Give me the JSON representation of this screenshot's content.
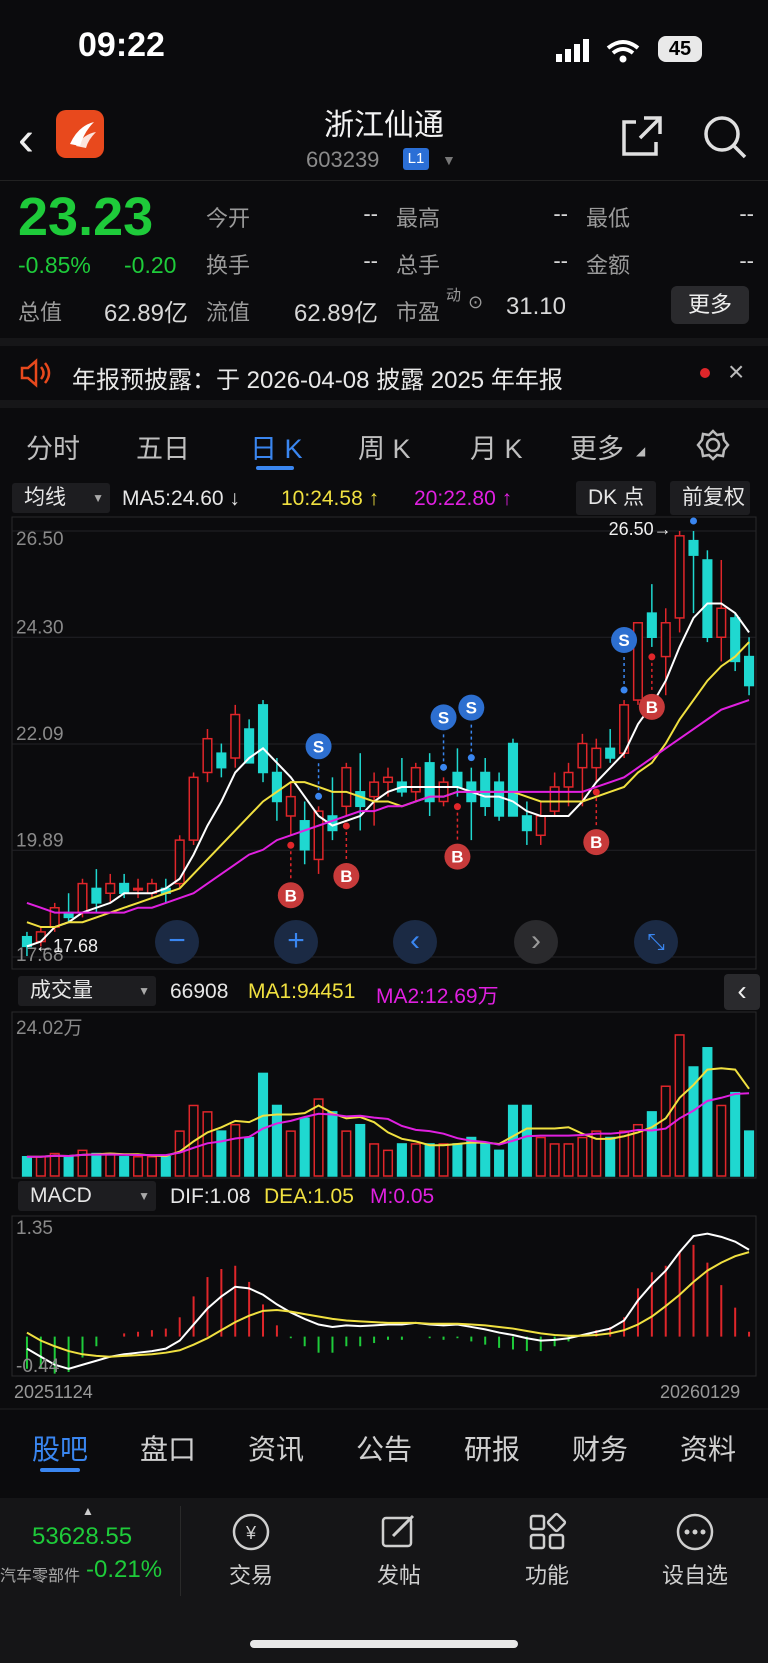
{
  "status_bar": {
    "time": "09:22",
    "battery": "45"
  },
  "header": {
    "title": "浙江仙通",
    "code": "603239",
    "level_badge": "L1"
  },
  "quote": {
    "price": "23.23",
    "change_pct": "-0.85%",
    "change_amt": "-0.20",
    "fields": [
      {
        "label": "今开",
        "value": "--"
      },
      {
        "label": "最高",
        "value": "--"
      },
      {
        "label": "最低",
        "value": "--"
      },
      {
        "label": "换手",
        "value": "--"
      },
      {
        "label": "总手",
        "value": "--"
      },
      {
        "label": "金额",
        "value": "--"
      },
      {
        "label": "总值",
        "value": "62.89亿"
      },
      {
        "label": "流值",
        "value": "62.89亿"
      },
      {
        "label": "市盈",
        "value": "31.10"
      }
    ],
    "pe_super": "动",
    "more_button": "更多",
    "price_color": "#1ecb3a"
  },
  "notice": {
    "text": "年报预披露：于 2026-04-08 披露 2025 年年报"
  },
  "chart_tabs": [
    "分时",
    "五日",
    "日 K",
    "周 K",
    "月 K",
    "更多"
  ],
  "active_chart_tab": "日 K",
  "main_chart": {
    "indicator_select": "均线",
    "ma5": "MA5:24.60 ↓",
    "ma10": "10:24.58 ↑",
    "ma20": "20:22.80 ↑",
    "dk_button": "DK 点",
    "adjust_button": "前复权",
    "max_label": "26.50→",
    "min_label": "←17.68",
    "colors": {
      "up": "#e0262a",
      "down": "#1fd8d0",
      "ma5": "#ffffff",
      "ma10": "#f0e040",
      "ma20": "#e020e0"
    }
  },
  "volume_panel": {
    "select": "成交量",
    "vol": "66908",
    "ma1": "MA1:94451",
    "ma2": "MA2:12.69万",
    "top_label": "24.02万"
  },
  "macd_panel": {
    "select": "MACD",
    "dif": "DIF:1.08",
    "dea": "DEA:1.05",
    "m": "M:0.05",
    "top_label": "1.35",
    "bottom_label": "-0.44"
  },
  "date_start": "20251124",
  "date_end": "20260129",
  "bottom_tabs": [
    "股吧",
    "盘口",
    "资讯",
    "公告",
    "研报",
    "财务",
    "资料"
  ],
  "dock": {
    "index_value": "53628.55",
    "index_name": "汽车零部件",
    "index_change": "-0.21%",
    "items": [
      {
        "label": "交易",
        "icon": "yen-icon"
      },
      {
        "label": "发帖",
        "icon": "edit-icon"
      },
      {
        "label": "功能",
        "icon": "grid-icon"
      },
      {
        "label": "设自选",
        "icon": "more-icon"
      }
    ]
  },
  "chart_data": {
    "type": "candlestick",
    "y_ticks": [
      "26.50",
      "24.30",
      "22.09",
      "19.89",
      "17.68"
    ],
    "ylim": [
      17.68,
      26.5
    ],
    "candles": [
      [
        18.1,
        18.2,
        17.7,
        17.9
      ],
      [
        18.0,
        18.3,
        17.9,
        18.2
      ],
      [
        18.3,
        18.8,
        18.2,
        18.7
      ],
      [
        18.6,
        19.0,
        18.4,
        18.5
      ],
      [
        18.6,
        19.3,
        18.5,
        19.2
      ],
      [
        19.1,
        19.5,
        18.6,
        18.8
      ],
      [
        19.0,
        19.4,
        18.8,
        19.2
      ],
      [
        19.2,
        19.4,
        18.9,
        19.0
      ],
      [
        19.1,
        19.3,
        18.9,
        19.1
      ],
      [
        19.0,
        19.3,
        18.9,
        19.2
      ],
      [
        19.1,
        19.3,
        18.8,
        19.0
      ],
      [
        19.2,
        20.2,
        19.1,
        20.1
      ],
      [
        20.1,
        21.5,
        20.0,
        21.4
      ],
      [
        21.5,
        22.4,
        21.3,
        22.2
      ],
      [
        21.9,
        22.1,
        21.4,
        21.6
      ],
      [
        21.8,
        22.9,
        21.6,
        22.7
      ],
      [
        22.4,
        22.6,
        21.7,
        21.7
      ],
      [
        22.9,
        23.0,
        21.3,
        21.5
      ],
      [
        21.5,
        21.8,
        20.5,
        20.9
      ],
      [
        20.6,
        21.3,
        20.2,
        21.0
      ],
      [
        20.5,
        20.9,
        19.6,
        19.9
      ],
      [
        19.7,
        20.8,
        19.4,
        20.7
      ],
      [
        20.6,
        21.4,
        20.1,
        20.3
      ],
      [
        20.8,
        21.7,
        20.6,
        21.6
      ],
      [
        21.1,
        21.9,
        20.3,
        20.8
      ],
      [
        21.0,
        21.5,
        20.4,
        21.3
      ],
      [
        21.3,
        21.6,
        21.0,
        21.4
      ],
      [
        21.3,
        21.8,
        21.0,
        21.1
      ],
      [
        21.1,
        21.7,
        20.9,
        21.6
      ],
      [
        21.7,
        21.9,
        20.6,
        20.9
      ],
      [
        20.9,
        21.4,
        20.8,
        21.3
      ],
      [
        21.5,
        22.0,
        21.0,
        21.2
      ],
      [
        21.3,
        21.6,
        20.1,
        20.9
      ],
      [
        21.5,
        21.8,
        20.6,
        20.8
      ],
      [
        21.3,
        21.5,
        20.5,
        20.6
      ],
      [
        22.1,
        22.2,
        20.6,
        20.6
      ],
      [
        20.6,
        20.9,
        20.0,
        20.3
      ],
      [
        20.2,
        20.9,
        20.0,
        20.6
      ],
      [
        20.7,
        21.5,
        20.6,
        21.2
      ],
      [
        21.2,
        21.7,
        20.8,
        21.5
      ],
      [
        21.6,
        22.3,
        20.8,
        22.1
      ],
      [
        21.6,
        22.2,
        21.3,
        22.0
      ],
      [
        22.0,
        22.4,
        21.7,
        21.8
      ],
      [
        21.9,
        23.0,
        21.8,
        22.9
      ],
      [
        23.0,
        24.6,
        22.9,
        24.6
      ],
      [
        24.8,
        25.4,
        24.1,
        24.3
      ],
      [
        23.9,
        24.9,
        23.1,
        24.6
      ],
      [
        24.7,
        26.5,
        24.4,
        26.4
      ],
      [
        26.3,
        26.5,
        24.8,
        26.0
      ],
      [
        25.9,
        26.1,
        24.2,
        24.3
      ],
      [
        24.3,
        25.9,
        23.8,
        24.9
      ],
      [
        24.7,
        24.8,
        23.6,
        23.8
      ],
      [
        23.9,
        24.3,
        23.1,
        23.3
      ]
    ],
    "ma5": [
      17.9,
      18.0,
      18.3,
      18.4,
      18.6,
      18.7,
      18.8,
      19.0,
      19.0,
      19.0,
      19.1,
      19.3,
      19.8,
      20.4,
      20.9,
      21.5,
      21.8,
      22.0,
      21.7,
      21.4,
      21.0,
      20.6,
      20.4,
      20.5,
      20.6,
      20.9,
      21.1,
      21.2,
      21.2,
      21.2,
      21.2,
      21.2,
      21.1,
      21.0,
      21.0,
      20.9,
      20.7,
      20.6,
      20.6,
      20.6,
      20.9,
      21.3,
      21.6,
      21.9,
      22.5,
      22.9,
      23.4,
      24.1,
      24.7,
      25.0,
      25.0,
      24.8,
      24.4
    ],
    "ma10": [
      18.4,
      18.3,
      18.3,
      18.4,
      18.4,
      18.5,
      18.6,
      18.7,
      18.8,
      18.9,
      19.0,
      19.1,
      19.4,
      19.7,
      20.0,
      20.3,
      20.6,
      20.9,
      21.1,
      21.3,
      21.3,
      21.2,
      21.1,
      21.1,
      21.0,
      20.9,
      20.9,
      20.8,
      20.9,
      21.0,
      21.0,
      21.1,
      21.1,
      21.1,
      21.1,
      21.1,
      21.0,
      20.9,
      20.9,
      20.9,
      20.9,
      21.0,
      21.1,
      21.2,
      21.5,
      21.7,
      22.1,
      22.6,
      23.0,
      23.4,
      23.7,
      23.9,
      24.2
    ],
    "ma20": [
      18.8,
      18.7,
      18.6,
      18.6,
      18.6,
      18.6,
      18.6,
      18.6,
      18.7,
      18.7,
      18.8,
      18.9,
      19.0,
      19.2,
      19.4,
      19.6,
      19.8,
      19.9,
      20.1,
      20.2,
      20.3,
      20.4,
      20.5,
      20.6,
      20.7,
      20.7,
      20.8,
      20.8,
      20.9,
      21.0,
      21.0,
      21.1,
      21.1,
      21.1,
      21.1,
      21.1,
      21.1,
      21.1,
      21.1,
      21.1,
      21.1,
      21.2,
      21.3,
      21.4,
      21.6,
      21.8,
      22.0,
      22.2,
      22.4,
      22.6,
      22.8,
      22.9,
      23.0
    ],
    "signals": [
      {
        "type": "S",
        "index": 21
      },
      {
        "type": "B",
        "index": 19
      },
      {
        "type": "B",
        "index": 23
      },
      {
        "type": "S",
        "index": 30
      },
      {
        "type": "S",
        "index": 32
      },
      {
        "type": "B",
        "index": 31
      },
      {
        "type": "B",
        "index": 41
      },
      {
        "type": "S",
        "index": 43
      },
      {
        "type": "B",
        "index": 45
      },
      {
        "type": "S",
        "index": 48
      }
    ],
    "volume": [
      3,
      3,
      3.5,
      3,
      4,
      3.5,
      3.5,
      3,
      3,
      3,
      3,
      7,
      11,
      10,
      7,
      8,
      6,
      16,
      11,
      7,
      9,
      12,
      10,
      7,
      8,
      5,
      4,
      5,
      5,
      5,
      5,
      5,
      6,
      5,
      4,
      11,
      11,
      6,
      5,
      5,
      6,
      7,
      6,
      7,
      8,
      10,
      14,
      22,
      17,
      20,
      11,
      13,
      7
    ],
    "vol_ylim": [
      0,
      24.02
    ],
    "macd_dif": [
      -0.15,
      -0.25,
      -0.35,
      -0.4,
      -0.35,
      -0.3,
      -0.25,
      -0.22,
      -0.2,
      -0.18,
      -0.15,
      -0.05,
      0.15,
      0.35,
      0.5,
      0.62,
      0.6,
      0.52,
      0.4,
      0.3,
      0.22,
      0.15,
      0.12,
      0.14,
      0.13,
      0.14,
      0.15,
      0.15,
      0.17,
      0.15,
      0.14,
      0.15,
      0.12,
      0.09,
      0.05,
      0.02,
      -0.02,
      -0.05,
      -0.04,
      -0.02,
      0.02,
      0.06,
      0.1,
      0.2,
      0.45,
      0.65,
      0.82,
      1.05,
      1.25,
      1.28,
      1.24,
      1.18,
      1.08
    ],
    "macd_dea": [
      0.05,
      -0.05,
      -0.12,
      -0.18,
      -0.22,
      -0.24,
      -0.25,
      -0.24,
      -0.23,
      -0.22,
      -0.2,
      -0.17,
      -0.1,
      -0.02,
      0.08,
      0.18,
      0.26,
      0.32,
      0.33,
      0.31,
      0.28,
      0.25,
      0.22,
      0.2,
      0.19,
      0.18,
      0.17,
      0.17,
      0.17,
      0.16,
      0.16,
      0.16,
      0.15,
      0.14,
      0.12,
      0.1,
      0.07,
      0.04,
      0.02,
      0.01,
      0.01,
      0.02,
      0.04,
      0.08,
      0.15,
      0.25,
      0.38,
      0.52,
      0.68,
      0.82,
      0.92,
      1.0,
      1.05
    ],
    "macd_ylim": [
      -0.44,
      1.35
    ]
  }
}
